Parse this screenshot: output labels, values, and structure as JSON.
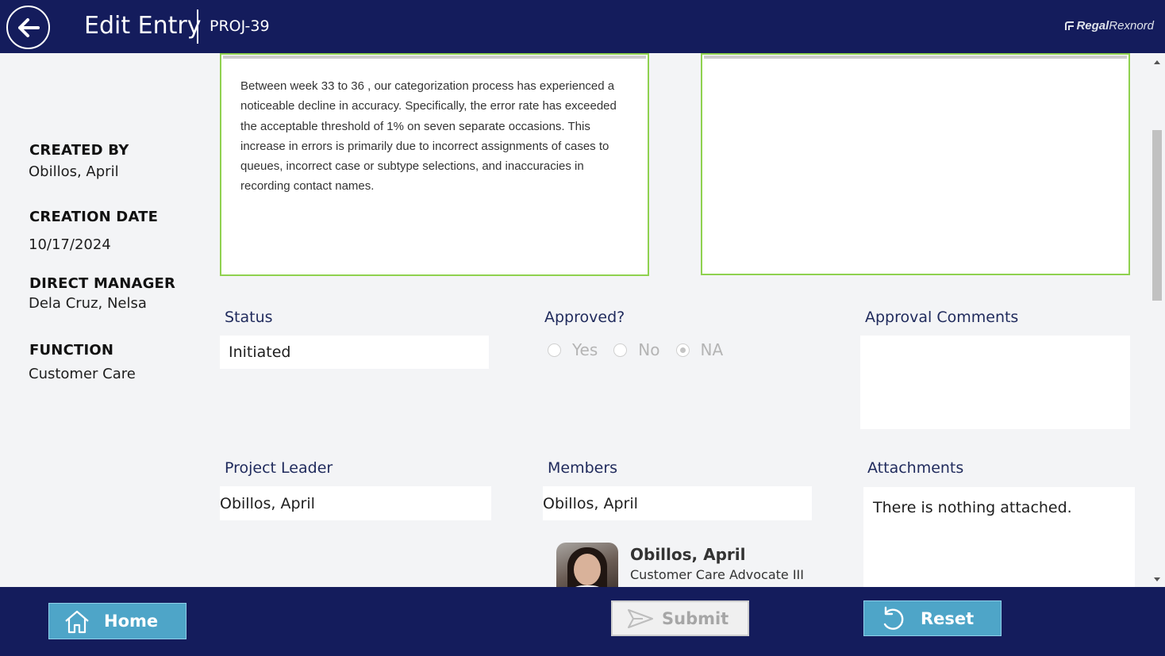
{
  "header": {
    "title": "Edit Entry",
    "project_id": "PROJ-39",
    "logo_bold": "Regal",
    "logo_light": "Rexnord"
  },
  "info": {
    "created_by_label": "CREATED BY",
    "created_by_value": "Obillos, April",
    "creation_date_label": "CREATION DATE",
    "creation_date_value": "10/17/2024",
    "direct_manager_label": "DIRECT MANAGER",
    "direct_manager_value": "Dela Cruz, Nelsa",
    "function_label": "FUNCTION",
    "function_value": "Customer Care"
  },
  "description": "Between week 33 to 36 , our categorization process has experienced a noticeable decline in accuracy. Specifically, the error rate has exceeded the acceptable threshold of 1% on seven separate occasions. This increase in errors is primarily due to incorrect assignments of cases to queues, incorrect case or subtype selections, and inaccuracies in recording contact names.",
  "right_textbox": "",
  "status": {
    "label": "Status",
    "value": "Initiated"
  },
  "approved": {
    "label": "Approved?",
    "options": [
      "Yes",
      "No",
      "NA"
    ],
    "selected": "NA"
  },
  "approval_comments": {
    "label": "Approval Comments",
    "value": ""
  },
  "project_leader": {
    "label": "Project Leader",
    "value": "Obillos, April"
  },
  "members": {
    "label": "Members",
    "value": "Obillos, April",
    "person_name": "Obillos, April",
    "person_role": "Customer Care Advocate III"
  },
  "attachments": {
    "label": "Attachments",
    "empty_text": "There is nothing attached."
  },
  "footer": {
    "home_label": "Home",
    "submit_label": "Submit",
    "reset_label": "Reset"
  },
  "colors": {
    "header_bg": "#141c5c",
    "accent_button": "#4ea5c8",
    "textbox_border": "#8fd14f",
    "label_color": "#1f2a5c"
  },
  "icons": {
    "back": "arrow-left-icon",
    "home": "home-icon",
    "submit": "send-icon",
    "reset": "undo-icon"
  }
}
